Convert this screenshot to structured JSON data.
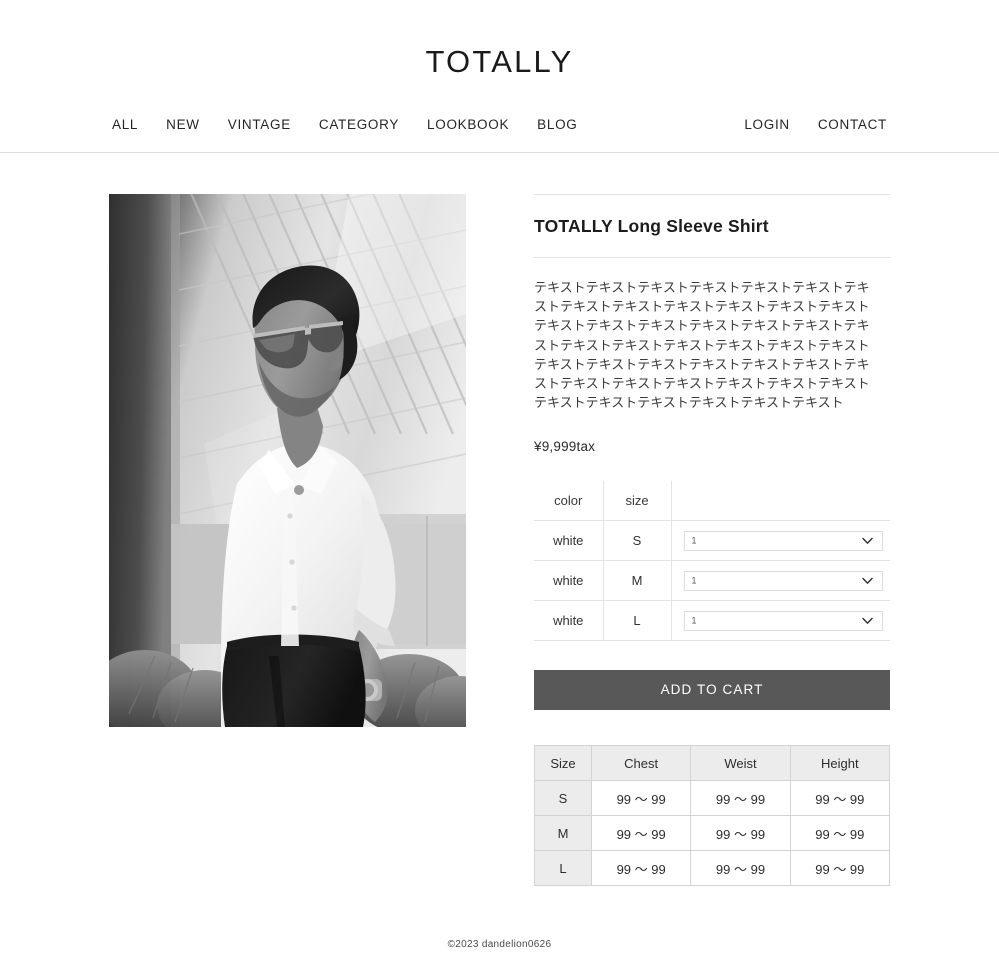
{
  "header": {
    "logo": "TOTALLY",
    "nav_left": [
      {
        "label": "ALL"
      },
      {
        "label": "NEW"
      },
      {
        "label": "VINTAGE"
      },
      {
        "label": "CATEGORY"
      },
      {
        "label": "LOOKBOOK"
      },
      {
        "label": "BLOG"
      }
    ],
    "nav_right": [
      {
        "label": "LOGIN"
      },
      {
        "label": "CONTACT"
      }
    ]
  },
  "product": {
    "image_alt": "man wearing white long sleeve shirt and sunglasses",
    "title": "TOTALLY Long Sleeve Shirt",
    "description": "テキストテキストテキストテキストテキストテキストテキストテキストテキストテキストテキストテキストテキストテキストテキストテキストテキストテキストテキストテキストテキストテキストテキストテキストテキストテキストテキストテキストテキストテキストテキストテキストテキストテキストテキストテキストテキストテキストテキストテキストテキストテキストテキストテキストテキスト",
    "price": "¥9,999tax",
    "variants": {
      "headers": [
        "color",
        "size",
        ""
      ],
      "rows": [
        {
          "color": "white",
          "size": "S",
          "qty": "1"
        },
        {
          "color": "white",
          "size": "M",
          "qty": "1"
        },
        {
          "color": "white",
          "size": "L",
          "qty": "1"
        }
      ]
    },
    "add_to_cart_label": "ADD TO CART",
    "size_chart": {
      "headers": [
        "Size",
        "Chest",
        "Weist",
        "Height"
      ],
      "rows": [
        {
          "size": "S",
          "chest": "99 〜 99",
          "weist": "99 〜 99",
          "height": "99 〜 99"
        },
        {
          "size": "M",
          "chest": "99 〜 99",
          "weist": "99 〜 99",
          "height": "99 〜 99"
        },
        {
          "size": "L",
          "chest": "99 〜 99",
          "weist": "99 〜 99",
          "height": "99 〜 99"
        }
      ]
    }
  },
  "footer": {
    "copyright": "©2023 dandelion0626"
  },
  "colors": {
    "button_bg": "#585858",
    "rule": "#e2e2e2",
    "chart_header_bg": "#ececec",
    "text": "#2b2b2b"
  }
}
